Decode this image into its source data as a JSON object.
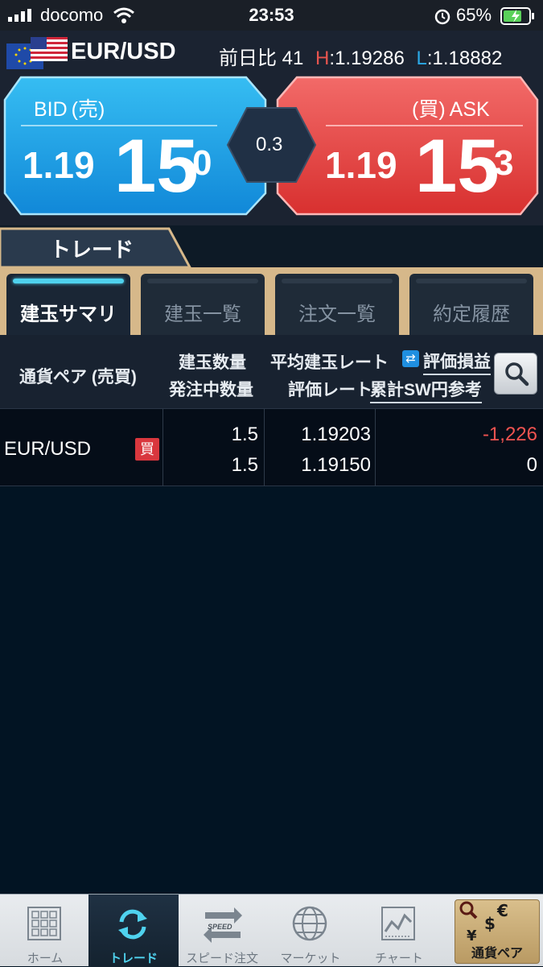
{
  "status_bar": {
    "carrier": "docomo",
    "time": "23:53",
    "battery": "65%"
  },
  "header": {
    "pair": "EUR/USD",
    "change_label": "前日比",
    "change_value": "41",
    "high_label": "H",
    "high_value": "1.19286",
    "low_label": "L",
    "low_value": "1.18882"
  },
  "quote": {
    "bid_label": "BID (売)",
    "bid_prefix": "1.19",
    "bid_big": "15",
    "bid_small": "0",
    "spread": "0.3",
    "ask_label": "(買) ASK",
    "ask_prefix": "1.19",
    "ask_big": "15",
    "ask_small": "3",
    "bid_color": "#1e9fe3",
    "ask_color": "#e0403f"
  },
  "trade_tab": "トレード",
  "sub_tabs": [
    "建玉サマリ",
    "建玉一覧",
    "注文一覧",
    "約定履歴"
  ],
  "table": {
    "col_pair": "通貨ペア (売買)",
    "col_qty": "建玉数量",
    "col_pending": "発注中数量",
    "col_avg_rate": "平均建玉レート",
    "col_eval_rate": "評価レート",
    "col_pnl": "評価損益",
    "col_swap": "累計SW円参考"
  },
  "rows": [
    {
      "pair": "EUR/USD",
      "side": "買",
      "qty": "1.5",
      "pending": "1.5",
      "avg_rate": "1.19203",
      "eval_rate": "1.19150",
      "pnl": "-1,226",
      "swap": "0"
    }
  ],
  "bottom_nav": [
    "ホーム",
    "トレード",
    "スピード注文",
    "マーケット",
    "チャート",
    "通貨ペア"
  ]
}
